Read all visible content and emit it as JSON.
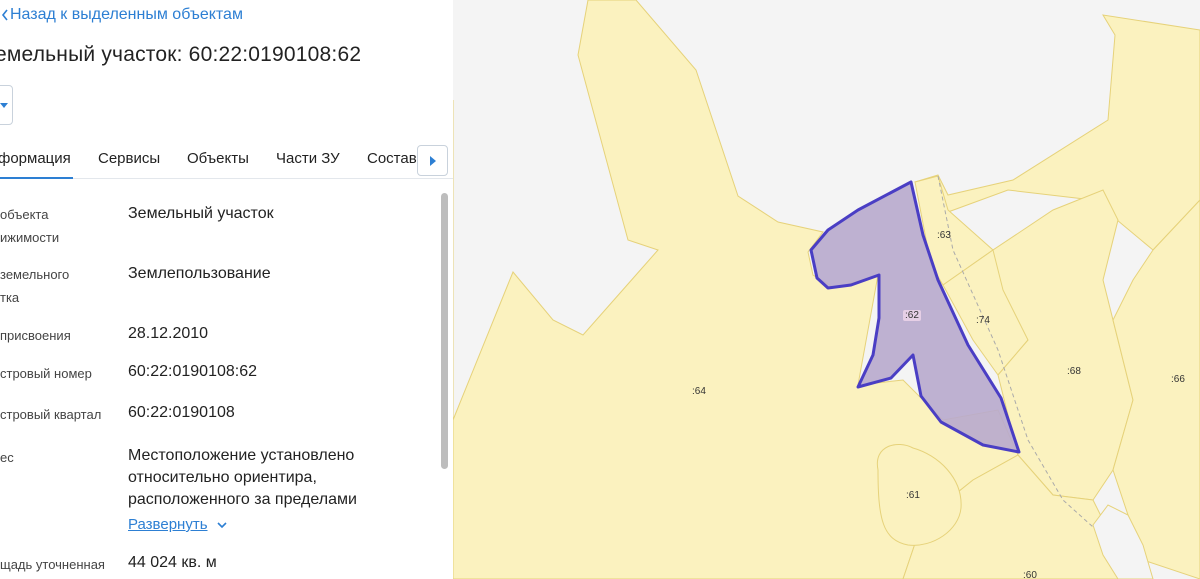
{
  "panel": {
    "back_label": "Назад к выделенным объектам",
    "title": "емельный участок: 60:22:0190108:62",
    "tabs": [
      {
        "label": "формация"
      },
      {
        "label": "Сервисы"
      },
      {
        "label": "Объекты"
      },
      {
        "label": "Части ЗУ"
      },
      {
        "label": "Состав"
      }
    ],
    "rows": [
      {
        "label_1": "объекта",
        "label_2": "ижимости",
        "value": "Земельный участок"
      },
      {
        "label_1": "земельного",
        "label_2": "тка",
        "value": "Землепользование"
      },
      {
        "label_1": "присвоения",
        "value": "28.12.2010"
      },
      {
        "label_1": "стровый номер",
        "value": "60:22:0190108:62"
      },
      {
        "label_1": "стровый квартал",
        "value": "60:22:0190108"
      },
      {
        "label_1": "ес",
        "value_lines": [
          "Местоположение установлено",
          "относительно ориентира,",
          "расположенного за пределами"
        ]
      },
      {
        "label_1": "щадь уточненная",
        "value": "44 024 кв. м"
      }
    ],
    "expand_label": "Развернуть"
  },
  "map": {
    "plot_labels": [
      ":63",
      ":62",
      ":74",
      ":68",
      ":66",
      ":64",
      ":61",
      ":60"
    ],
    "colors": {
      "background": "#f4f4f4",
      "parcel_fill": "#fbf2bf",
      "parcel_stroke": "#e6d27a",
      "selected_fill": "#b8aacd",
      "selected_stroke": "#4a3ec4"
    }
  }
}
